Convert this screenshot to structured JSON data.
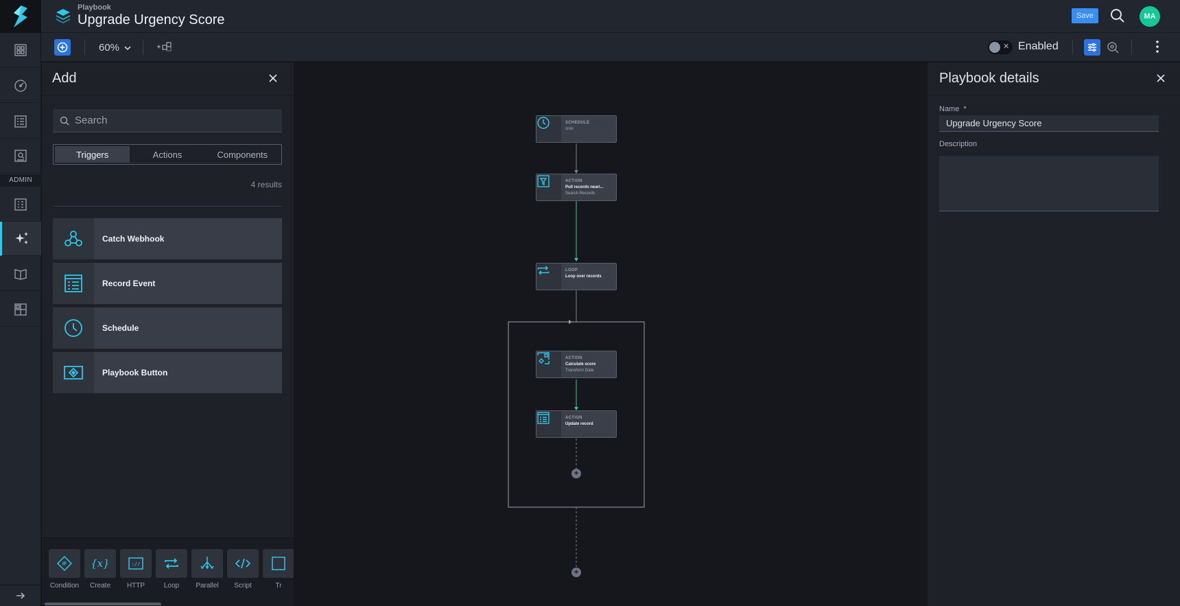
{
  "header": {
    "breadcrumb": "Playbook",
    "title": "Upgrade Urgency Score",
    "save_label": "Save",
    "avatar_initials": "MA"
  },
  "rail": {
    "admin_label": "ADMIN"
  },
  "toolbar": {
    "zoom": "60%",
    "enabled_label": "Enabled",
    "enabled": false
  },
  "add_panel": {
    "title": "Add",
    "search_placeholder": "Search",
    "tabs": [
      "Triggers",
      "Actions",
      "Components"
    ],
    "active_tab": "Triggers",
    "results": "4 results",
    "triggers": [
      {
        "label": "Catch Webhook",
        "icon": "webhook-icon"
      },
      {
        "label": "Record Event",
        "icon": "record-event-icon"
      },
      {
        "label": "Schedule",
        "icon": "clock-icon"
      },
      {
        "label": "Playbook Button",
        "icon": "playbook-button-icon"
      }
    ],
    "tools": [
      {
        "label": "Condition",
        "icon": "condition-icon"
      },
      {
        "label": "Create",
        "icon": "create-variable-icon"
      },
      {
        "label": "HTTP",
        "icon": "http-icon"
      },
      {
        "label": "Loop",
        "icon": "loop-icon"
      },
      {
        "label": "Parallel",
        "icon": "parallel-icon"
      },
      {
        "label": "Script",
        "icon": "script-icon"
      },
      {
        "label": "Tr",
        "icon": "transform-icon"
      }
    ]
  },
  "canvas": {
    "nodes": [
      {
        "kind": "SCHEDULE",
        "name": "cron",
        "sub": ""
      },
      {
        "kind": "ACTION",
        "name": "Pull records neari...",
        "sub": "Search Records"
      },
      {
        "kind": "LOOP",
        "name": "Loop over records",
        "sub": ""
      },
      {
        "kind": "ACTION",
        "name": "Calculate score",
        "sub": "Transform Data"
      },
      {
        "kind": "ACTION",
        "name": "Update record",
        "sub": ""
      }
    ],
    "add_step_symbol": "+"
  },
  "details": {
    "title": "Playbook details",
    "name_label": "Name",
    "required_mark": "*",
    "name_value": "Upgrade Urgency Score",
    "description_label": "Description",
    "description_value": ""
  },
  "colors": {
    "accent": "#2ec7e8",
    "primary": "#2b74e0",
    "success_edge": "#2fd27a",
    "avatar": "#16c79a"
  }
}
